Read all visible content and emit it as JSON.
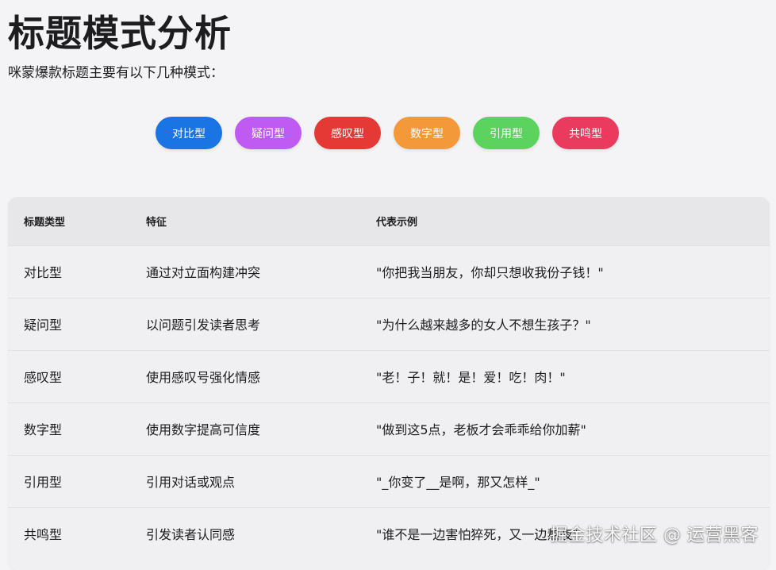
{
  "page": {
    "title": "标题模式分析",
    "subtitle": "咪蒙爆款标题主要有以下几种模式："
  },
  "tags": [
    {
      "label": "对比型",
      "color": "#1a74e3"
    },
    {
      "label": "疑问型",
      "color": "#bf5af2"
    },
    {
      "label": "感叹型",
      "color": "#e53935"
    },
    {
      "label": "数字型",
      "color": "#f4993a"
    },
    {
      "label": "引用型",
      "color": "#5bd35e"
    },
    {
      "label": "共鸣型",
      "color": "#ea3b5f"
    }
  ],
  "table": {
    "headers": [
      "标题类型",
      "特征",
      "代表示例"
    ],
    "rows": [
      [
        "对比型",
        "通过对立面构建冲突",
        "\"你把我当朋友，你却只想收我份子钱！\""
      ],
      [
        "疑问型",
        "以问题引发读者思考",
        "\"为什么越来越多的女人不想生孩子？\""
      ],
      [
        "感叹型",
        "使用感叹号强化情感",
        "\"老！子！就！是！爱！吃！肉！\""
      ],
      [
        "数字型",
        "使用数字提高可信度",
        "\"做到这5点，老板才会乖乖给你加薪\""
      ],
      [
        "引用型",
        "引用对话或观点",
        "\"_你变了__是啊，那又怎样_\""
      ],
      [
        "共鸣型",
        "引发读者认同感",
        "\"谁不是一边害怕猝死，又一边熬夜\""
      ]
    ]
  },
  "watermark": "掘金技术社区 @ 运营黑客"
}
